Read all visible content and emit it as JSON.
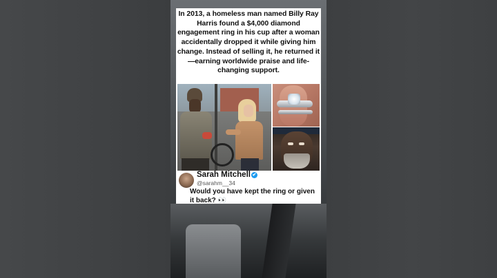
{
  "post": {
    "caption": "In 2013, a homeless man named Billy Ray Harris found a $4,000 diamond engagement ring in his cup after a woman accidentally dropped it while giving him change. Instead of selling it, he returned it—earning worldwide praise and life-changing support.",
    "author_name": "Sarah Mitchell",
    "author_handle": "@sarahm__34",
    "verified_icon": "✔",
    "question": "Would you have kept the ring or given it back? 👀"
  },
  "icons": [
    "verified-badge-icon"
  ],
  "colors": {
    "verified": "#1d9bf0",
    "card_bg": "#ffffff",
    "side_bg": "#424446"
  }
}
